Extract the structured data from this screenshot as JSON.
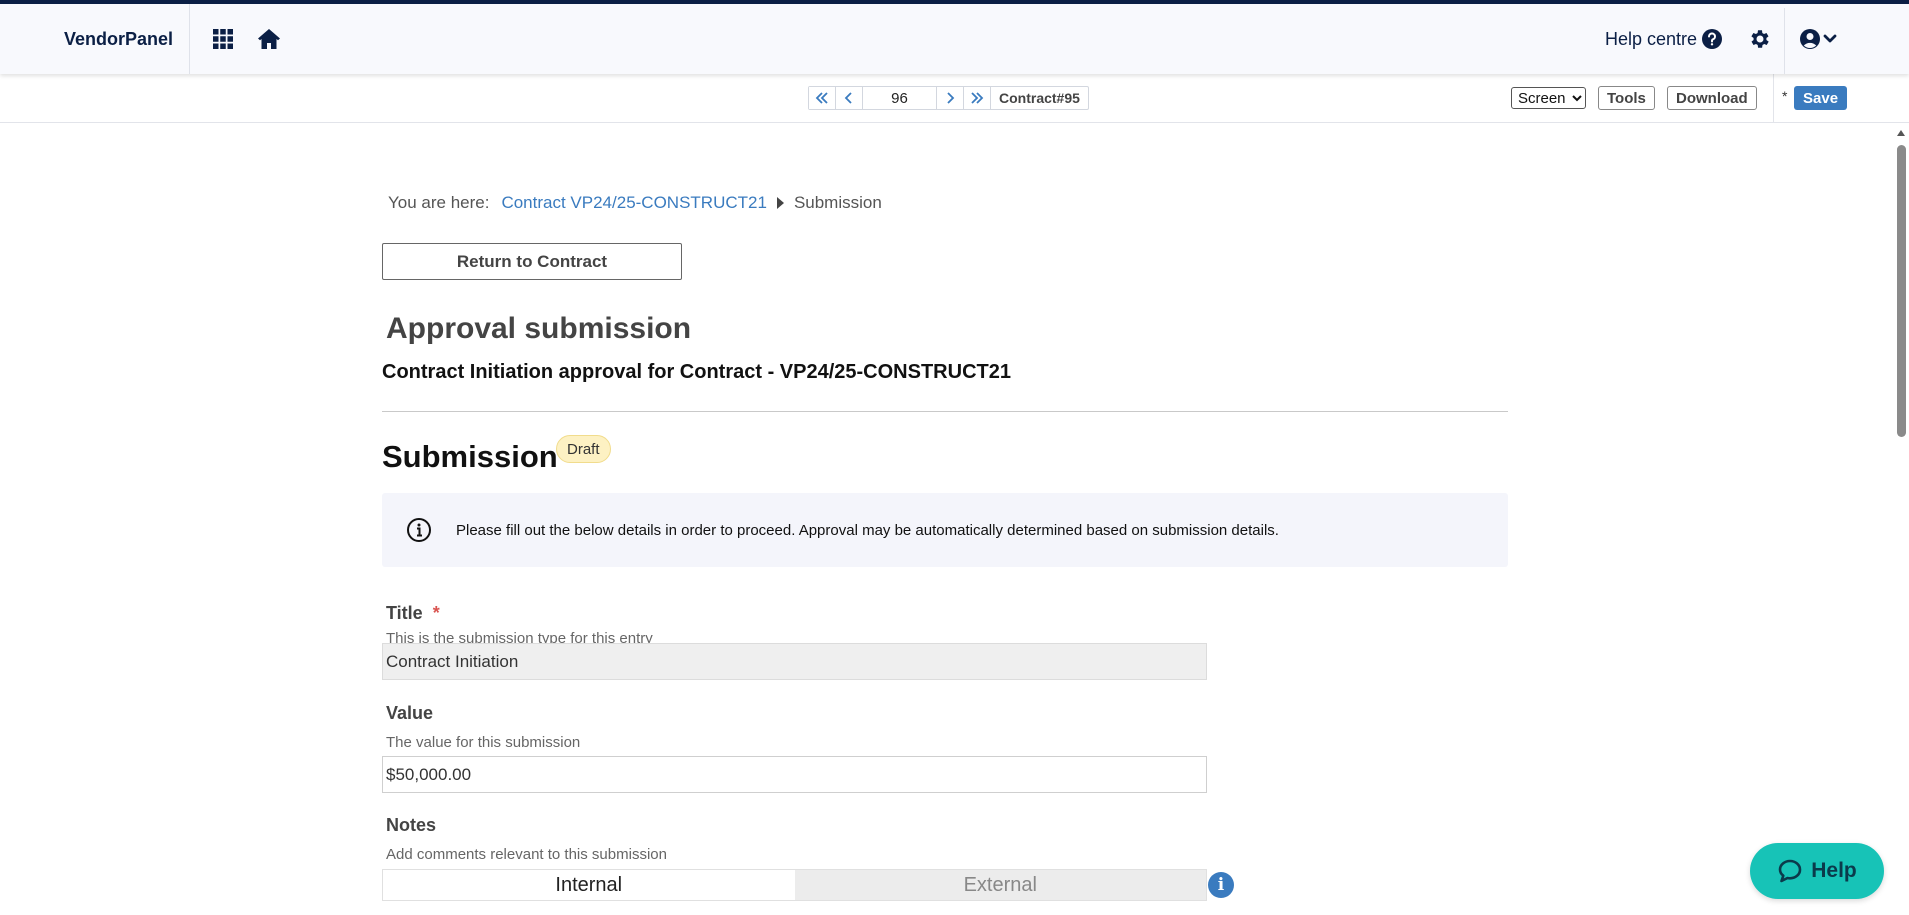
{
  "topbar": {
    "brand": "VendorPanel",
    "help_centre_label": "Help centre",
    "icons": [
      "apps-grid-icon",
      "home-icon",
      "question-circle-icon",
      "gear-icon",
      "user-circle-icon",
      "chevron-down-icon"
    ]
  },
  "toolbar": {
    "page_number": "96",
    "contract_id": "Contract#95",
    "view_select": {
      "selected": "Screen"
    },
    "tools_label": "Tools",
    "download_label": "Download",
    "unsaved_marker": "*",
    "save_label": "Save"
  },
  "breadcrumb": {
    "label": "You are here:",
    "link": "Contract VP24/25-CONSTRUCT21",
    "current": "Submission"
  },
  "return_button": "Return to Contract",
  "page_title": "Approval submission",
  "page_subtitle": "Contract Initiation approval for Contract - VP24/25-CONSTRUCT21",
  "section": {
    "title": "Submission",
    "status": "Draft"
  },
  "info_message": "Please fill out the below details in order to proceed. Approval may be automatically determined based on submission details.",
  "fields": {
    "title": {
      "label": "Title",
      "required_marker": "*",
      "help": "This is the submission type for this entry",
      "value": "Contract Initiation"
    },
    "value": {
      "label": "Value",
      "help": "The value for this submission",
      "value": "$50,000.00"
    },
    "notes": {
      "label": "Notes",
      "help": "Add comments relevant to this submission",
      "tabs": [
        {
          "label": "Internal",
          "active": true
        },
        {
          "label": "External",
          "active": false
        }
      ],
      "info_glyph": "i"
    }
  },
  "help_button": "Help",
  "colors": {
    "navy": "#0b1f45",
    "accent_blue": "#3a7bbf",
    "draft_badge": "#fdf1c3",
    "help_teal": "#17c3b7"
  }
}
